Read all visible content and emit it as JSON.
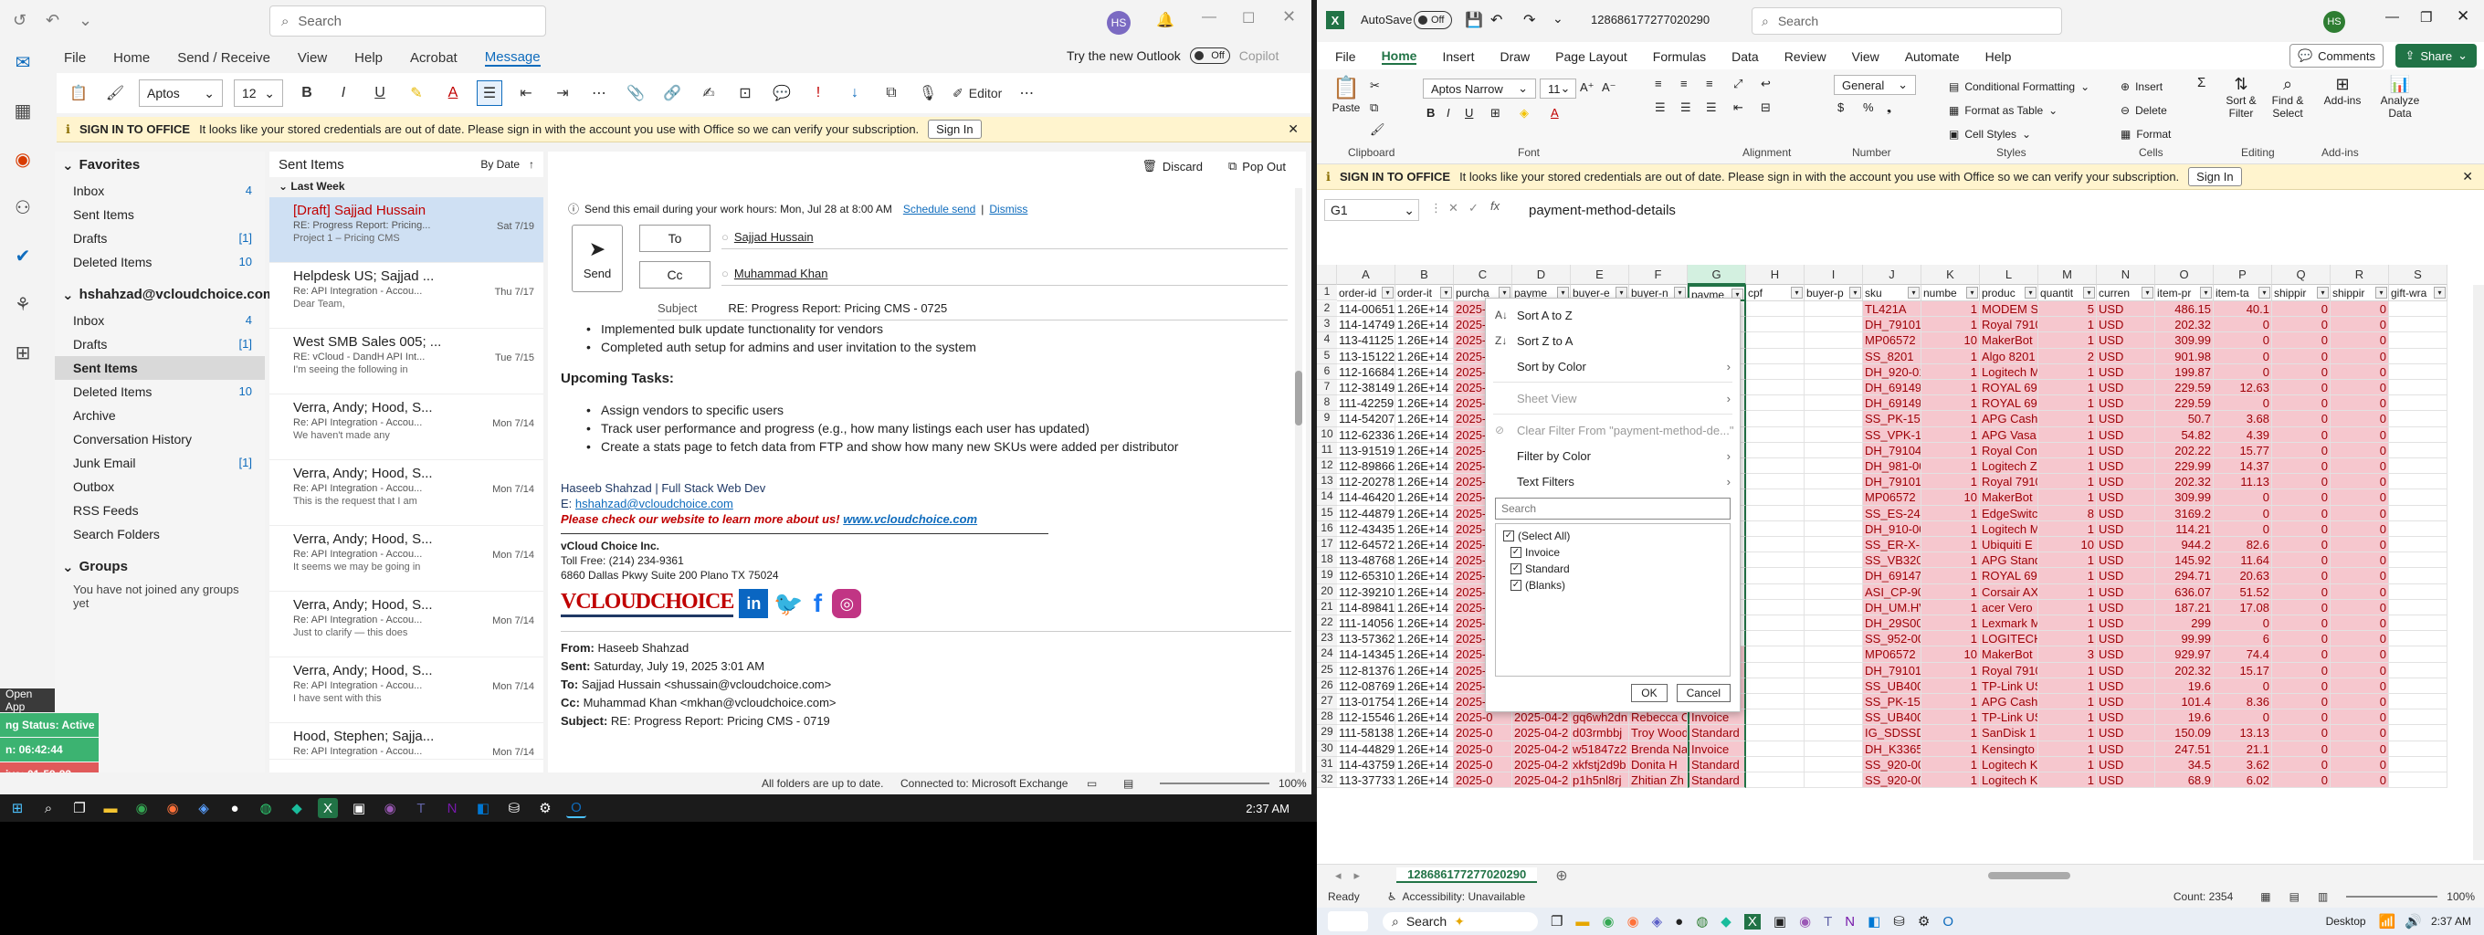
{
  "outlook": {
    "search_placeholder": "Search",
    "avatar": "HS",
    "menu": [
      "File",
      "Home",
      "Send / Receive",
      "View",
      "Help",
      "Acrobat",
      "Message"
    ],
    "try_new": "Try the new Outlook",
    "toggle": "Off",
    "copilot": "Copilot",
    "font_name": "Aptos",
    "font_size": "12",
    "editor": "Editor",
    "infobar": {
      "title": "SIGN IN TO OFFICE",
      "text": "It looks like your stored credentials are out of date. Please sign in with the account you use with Office so we can verify your subscription.",
      "button": "Sign In"
    },
    "favorites_title": "Favorites",
    "favorites": [
      {
        "label": "Inbox",
        "count": "4"
      },
      {
        "label": "Sent Items",
        "count": ""
      },
      {
        "label": "Drafts",
        "count": "[1]"
      },
      {
        "label": "Deleted Items",
        "count": "10"
      }
    ],
    "account": "hshahzad@vcloudchoice.com",
    "folders": [
      {
        "label": "Inbox",
        "count": "4"
      },
      {
        "label": "Drafts",
        "count": "[1]"
      },
      {
        "label": "Sent Items",
        "count": ""
      },
      {
        "label": "Deleted Items",
        "count": "10"
      },
      {
        "label": "Archive",
        "count": ""
      },
      {
        "label": "Conversation History",
        "count": ""
      },
      {
        "label": "Junk Email",
        "count": "[1]"
      },
      {
        "label": "Outbox",
        "count": ""
      },
      {
        "label": "RSS Feeds",
        "count": ""
      },
      {
        "label": "Search Folders",
        "count": ""
      }
    ],
    "groups_title": "Groups",
    "groups_text": "You have not joined any groups yet",
    "list_title": "Sent Items",
    "sort": "By Date",
    "section": "Last Week",
    "messages": [
      {
        "from": "[Draft] Sajjad Hussain",
        "subj": "RE: Progress Report: Pricing...",
        "prev": "Project 1 – Pricing CMS",
        "date": "Sat 7/19"
      },
      {
        "from": "Helpdesk US; Sajjad ...",
        "subj": "Re: API Integration - Accou...",
        "prev": "Dear Team,",
        "date": "Thu 7/17"
      },
      {
        "from": "West SMB Sales 005; ...",
        "subj": "RE: vCloud - DandH API Int...",
        "prev": "I'm seeing the following in",
        "date": "Tue 7/15"
      },
      {
        "from": "Verra, Andy; Hood, S...",
        "subj": "Re: API Integration - Accou...",
        "prev": "We haven't made any",
        "date": "Mon 7/14"
      },
      {
        "from": "Verra, Andy; Hood, S...",
        "subj": "Re: API Integration - Accou...",
        "prev": "This is the request that I am",
        "date": "Mon 7/14"
      },
      {
        "from": "Verra, Andy; Hood, S...",
        "subj": "Re: API Integration - Accou...",
        "prev": "It seems we may be going in",
        "date": "Mon 7/14"
      },
      {
        "from": "Verra, Andy; Hood, S...",
        "subj": "Re: API Integration - Accou...",
        "prev": "Just to clarify — this does",
        "date": "Mon 7/14"
      },
      {
        "from": "Verra, Andy; Hood, S...",
        "subj": "Re: API Integration - Accou...",
        "prev": "I have sent with this",
        "date": "Mon 7/14"
      },
      {
        "from": "Hood, Stephen; Sajja...",
        "subj": "Re: API Integration - Accou...",
        "prev": "",
        "date": "Mon 7/14"
      }
    ],
    "reading": {
      "discard": "Discard",
      "popout": "Pop Out",
      "schedule_notice": "Send this email during your work hours: Mon, Jul 28 at 8:00 AM",
      "schedule_link": "Schedule send",
      "dismiss": "Dismiss",
      "send": "Send",
      "to_label": "To",
      "cc_label": "Cc",
      "to": "Sajjad Hussain",
      "cc": "Muhammad Khan",
      "subject_label": "Subject",
      "subject": "RE: Progress Report: Pricing CMS - 0725",
      "partial_bullet": "Implemented bulk update functionality for vendors",
      "bullet2": "Completed auth setup for admins and user invitation to the system",
      "upcoming": "Upcoming Tasks:",
      "tasks": [
        "Assign vendors to specific users",
        "Track user performance and progress (e.g., how many listings each user has updated)",
        "Create a stats page to fetch data from FTP and show how many new SKUs were added per distributor"
      ],
      "sig_name": "Haseeb Shahzad | Full Stack Web Dev",
      "sig_email_label": "E:",
      "sig_email": "hshahzad@vcloudchoice.com",
      "sig_promo": "Please check our website to learn more about us!",
      "sig_url": "www.vcloudchoice.com",
      "company": "vCloud Choice Inc.",
      "tollfree": "Toll Free: (214) 234-9361",
      "address": "6860 Dallas Pkwy Suite 200 Plano TX 75024",
      "logo": "VCLOUDCHOICE",
      "from_label": "From:",
      "from": "Haseeb Shahzad",
      "sent_label": "Sent:",
      "sent": "Saturday, July 19, 2025 3:01 AM",
      "to2_label": "To:",
      "to2": "Sajjad Hussain <shussain@vcloudchoice.com>",
      "cc2_label": "Cc:",
      "cc2": "Muhammad Khan <mkhan@vcloudchoice.com>",
      "subject2_label": "Subject:",
      "subject2": "RE: Progress Report: Pricing CMS - 0719"
    },
    "status": {
      "left": "All folders are up to date.",
      "mid": "Connected to: Microsoft Exchange",
      "zoom": "100%"
    },
    "side_widget": {
      "open": "Open App",
      "status": "ng Status: Active",
      "t1": "n: 06:42:44",
      "t2": "ive: 01:59:23"
    }
  },
  "taskbar": {
    "time": "2:37 AM"
  },
  "excel": {
    "autosave": "AutoSave",
    "autosave_state": "Off",
    "filename": "1286861772770202​90",
    "search_placeholder": "Search",
    "avatar": "HS",
    "menu": [
      "File",
      "Home",
      "Insert",
      "Draw",
      "Page Layout",
      "Formulas",
      "Data",
      "Review",
      "View",
      "Automate",
      "Help"
    ],
    "comments": "Comments",
    "share": "Share",
    "font_name": "Aptos Narrow",
    "font_size": "11",
    "number_format": "General",
    "styles": [
      "Conditional Formatting",
      "Format as Table",
      "Cell Styles"
    ],
    "cells_btns": [
      "Insert",
      "Delete",
      "Format"
    ],
    "editing_btns": [
      "Sort & Filter",
      "Find & Select"
    ],
    "addins": "Add-ins",
    "analyze": "Analyze Data",
    "paste": "Paste",
    "groups": [
      "Clipboard",
      "Font",
      "Alignment",
      "Number",
      "Styles",
      "Cells",
      "Editing",
      "Add-ins"
    ],
    "infobar": {
      "title": "SIGN IN TO OFFICE",
      "text": "It looks like your stored credentials are out of date. Please sign in with the account you use with Office so we can verify your subscription.",
      "button": "Sign In"
    },
    "namebox": "G1",
    "formula": "payment-method-details",
    "columns": [
      "A",
      "B",
      "C",
      "D",
      "E",
      "F",
      "G",
      "H",
      "I",
      "J",
      "K",
      "L",
      "M",
      "N",
      "O",
      "P",
      "Q",
      "R",
      "S"
    ],
    "headers": [
      "order-id",
      "order-it",
      "purcha",
      "payme",
      "buyer-e",
      "buyer-n",
      "payme",
      "cpf",
      "buyer-p",
      "sku",
      "numbe",
      "produc",
      "quantit",
      "curren",
      "item-pr",
      "item-ta",
      "shippir",
      "shippir",
      "gift-wra"
    ],
    "rows": [
      [
        "114-00651",
        "1.26E+14",
        "2025-0",
        "",
        "",
        "",
        "",
        "",
        "",
        "TL421A",
        "1",
        "MODEM SE",
        "5",
        "USD",
        "486.15",
        "40.1",
        "0",
        "0",
        ""
      ],
      [
        "114-14749",
        "1.26E+14",
        "2025-0",
        "",
        "",
        "",
        "",
        "",
        "",
        "DH_79101",
        "1",
        "Royal 7910",
        "1",
        "USD",
        "202.32",
        "0",
        "0",
        "0",
        ""
      ],
      [
        "113-41125",
        "1.26E+14",
        "2025-0",
        "",
        "",
        "",
        "",
        "",
        "",
        "MP06572",
        "10",
        "MakerBot",
        "1",
        "USD",
        "309.99",
        "0",
        "0",
        "0",
        ""
      ],
      [
        "113-15122",
        "1.26E+14",
        "2025-0",
        "",
        "",
        "",
        "",
        "",
        "",
        "SS_8201",
        "1",
        "Algo 8201",
        "2",
        "USD",
        "901.98",
        "0",
        "0",
        "0",
        ""
      ],
      [
        "112-16684",
        "1.26E+14",
        "2025-0",
        "",
        "",
        "",
        "",
        "",
        "",
        "DH_920-01",
        "1",
        "Logitech M",
        "1",
        "USD",
        "199.87",
        "0",
        "0",
        "0",
        ""
      ],
      [
        "112-38149",
        "1.26E+14",
        "2025-0",
        "",
        "",
        "",
        "",
        "",
        "",
        "DH_69149",
        "1",
        "ROYAL 691",
        "1",
        "USD",
        "229.59",
        "12.63",
        "0",
        "0",
        ""
      ],
      [
        "111-42259",
        "1.26E+14",
        "2025-0",
        "",
        "",
        "",
        "",
        "",
        "",
        "DH_69149",
        "1",
        "ROYAL 691",
        "1",
        "USD",
        "229.59",
        "0",
        "0",
        "0",
        ""
      ],
      [
        "114-54207",
        "1.26E+14",
        "2025-0",
        "",
        "",
        "",
        "",
        "",
        "",
        "SS_PK-15V",
        "1",
        "APG Cash",
        "1",
        "USD",
        "50.7",
        "3.68",
        "0",
        "0",
        ""
      ],
      [
        "112-62336",
        "1.26E+14",
        "2025-0",
        "",
        "",
        "",
        "",
        "",
        "",
        "SS_VPK-15",
        "1",
        "APG Vasa",
        "1",
        "USD",
        "54.82",
        "4.39",
        "0",
        "0",
        ""
      ],
      [
        "113-91519",
        "1.26E+14",
        "2025-0",
        "",
        "",
        "",
        "",
        "",
        "",
        "DH_79104",
        "1",
        "Royal Con",
        "1",
        "USD",
        "202.22",
        "15.77",
        "0",
        "0",
        ""
      ],
      [
        "112-89866",
        "1.26E+14",
        "2025-0",
        "",
        "",
        "",
        "",
        "",
        "",
        "DH_981-00",
        "1",
        "Logitech Z",
        "1",
        "USD",
        "229.99",
        "14.37",
        "0",
        "0",
        ""
      ],
      [
        "112-20278",
        "1.26E+14",
        "2025-0",
        "",
        "",
        "",
        "",
        "",
        "",
        "DH_79101",
        "1",
        "Royal 7910",
        "1",
        "USD",
        "202.32",
        "11.13",
        "0",
        "0",
        ""
      ],
      [
        "114-46420",
        "1.26E+14",
        "2025-0",
        "",
        "",
        "",
        "",
        "",
        "",
        "MP06572",
        "10",
        "MakerBot",
        "1",
        "USD",
        "309.99",
        "0",
        "0",
        "0",
        ""
      ],
      [
        "112-44879",
        "1.26E+14",
        "2025-0",
        "",
        "",
        "",
        "",
        "",
        "",
        "SS_ES-24-2",
        "1",
        "EdgeSwitc",
        "8",
        "USD",
        "3169.2",
        "0",
        "0",
        "0",
        ""
      ],
      [
        "112-43435",
        "1.26E+14",
        "2025-0",
        "",
        "",
        "",
        "",
        "",
        "",
        "DH_910-00",
        "1",
        "Logitech M",
        "1",
        "USD",
        "114.21",
        "0",
        "0",
        "0",
        ""
      ],
      [
        "112-64572",
        "1.26E+14",
        "2025-0",
        "",
        "",
        "",
        "",
        "",
        "",
        "SS_ER-X-S",
        "1",
        "Ubiquiti E",
        "10",
        "USD",
        "944.2",
        "82.6",
        "0",
        "0",
        ""
      ],
      [
        "113-48768",
        "1.26E+14",
        "2025-0",
        "",
        "",
        "",
        "",
        "",
        "",
        "SS_VB320-",
        "1",
        "APG Stand",
        "1",
        "USD",
        "145.92",
        "11.64",
        "0",
        "0",
        ""
      ],
      [
        "112-65310",
        "1.26E+14",
        "2025-0",
        "",
        "",
        "",
        "",
        "",
        "",
        "DH_69147",
        "1",
        "ROYAL 691",
        "1",
        "USD",
        "294.71",
        "20.63",
        "0",
        "0",
        ""
      ],
      [
        "112-39210",
        "1.26E+14",
        "2025-0",
        "",
        "",
        "",
        "",
        "",
        "",
        "ASI_CP-90",
        "1",
        "Corsair AX",
        "1",
        "USD",
        "636.07",
        "51.52",
        "0",
        "0",
        ""
      ],
      [
        "114-89841",
        "1.26E+14",
        "2025-0",
        "",
        "",
        "",
        "",
        "",
        "",
        "DH_UM.HV",
        "1",
        "acer Vero",
        "1",
        "USD",
        "187.21",
        "17.08",
        "0",
        "0",
        ""
      ],
      [
        "111-14056",
        "1.26E+14",
        "2025-0",
        "",
        "",
        "",
        "",
        "",
        "",
        "DH_29S00",
        "1",
        "Lexmark M",
        "1",
        "USD",
        "299",
        "0",
        "0",
        "0",
        ""
      ],
      [
        "113-57362",
        "1.26E+14",
        "2025-0",
        "",
        "",
        "",
        "",
        "",
        "",
        "SS_952-00",
        "1",
        "LOGITECH",
        "1",
        "USD",
        "99.99",
        "6",
        "0",
        "0",
        ""
      ],
      [
        "114-14345",
        "1.26E+14",
        "2025-0",
        "",
        "",
        "",
        "",
        "",
        "",
        "MP06572",
        "10",
        "MakerBot",
        "3",
        "USD",
        "929.97",
        "74.4",
        "0",
        "0",
        ""
      ],
      [
        "112-81376",
        "1.26E+14",
        "2025-0",
        "2025-04-2",
        "5tq7ygs00",
        "Luke",
        "Standard",
        "",
        "",
        "DH_79101",
        "1",
        "Royal 7910",
        "1",
        "USD",
        "202.32",
        "15.17",
        "0",
        "0",
        ""
      ],
      [
        "112-08769",
        "1.26E+14",
        "2025-0",
        "2025-04-2",
        "x5hwwd7j",
        "City of Wa",
        "Standard",
        "",
        "",
        "SS_UB400",
        "1",
        "TP-Link US",
        "1",
        "USD",
        "19.6",
        "0",
        "0",
        "0",
        ""
      ],
      [
        "113-01754",
        "1.26E+14",
        "2025-0",
        "2025-04-2",
        "fwqk27nw",
        "Taleb sale",
        "Standard",
        "",
        "",
        "SS_PK-15V",
        "1",
        "APG Cash",
        "1",
        "USD",
        "101.4",
        "8.36",
        "0",
        "0",
        ""
      ],
      [
        "112-15546",
        "1.26E+14",
        "2025-0",
        "2025-04-2",
        "gq6wh2dn",
        "Rebecca C",
        "Invoice",
        "",
        "",
        "SS_UB400",
        "1",
        "TP-Link US",
        "1",
        "USD",
        "19.6",
        "0",
        "0",
        "0",
        ""
      ],
      [
        "111-58138",
        "1.26E+14",
        "2025-0",
        "2025-04-2",
        "d03rmbbj",
        "Troy Wood",
        "Standard",
        "",
        "",
        "IG_SDSSDI",
        "1",
        "SanDisk 1",
        "1",
        "USD",
        "150.09",
        "13.13",
        "0",
        "0",
        ""
      ],
      [
        "114-44829",
        "1.26E+14",
        "2025-0",
        "2025-04-2",
        "w51847z2",
        "Brenda Na",
        "Invoice",
        "",
        "",
        "DH_K33650",
        "1",
        "Kensingto",
        "1",
        "USD",
        "247.51",
        "21.1",
        "0",
        "0",
        ""
      ],
      [
        "114-43759",
        "1.26E+14",
        "2025-0",
        "2025-04-2",
        "xkfstj2d9b",
        "Donita H",
        "Standard",
        "",
        "",
        "SS_920-00",
        "1",
        "Logitech K",
        "1",
        "USD",
        "34.5",
        "3.62",
        "0",
        "0",
        ""
      ],
      [
        "113-37733",
        "1.26E+14",
        "2025-0",
        "2025-04-2",
        "p1h5nl8rj",
        "Zhitian Zh",
        "Standard",
        "",
        "",
        "SS_920-00",
        "1",
        "Logitech K",
        "1",
        "USD",
        "68.9",
        "6.02",
        "0",
        "0",
        ""
      ]
    ],
    "filter_menu": {
      "sort_az": "Sort A to Z",
      "sort_za": "Sort Z to A",
      "sort_color": "Sort by Color",
      "sheet_view": "Sheet View",
      "clear": "Clear Filter From \"payment-method-de...\"",
      "filter_color": "Filter by Color",
      "text_filters": "Text Filters",
      "search": "Search",
      "options": [
        "(Select All)",
        "Invoice",
        "Standard",
        "(Blanks)"
      ],
      "ok": "OK",
      "cancel": "Cancel"
    },
    "sheet_tab": "128686177277020290",
    "status": {
      "ready": "Ready",
      "accessibility": "Accessibility: Unavailable",
      "count": "Count: 2354",
      "zoom": "100%"
    },
    "taskbar": {
      "search": "Search",
      "desktop": "Desktop",
      "time": "2:37 AM"
    }
  },
  "colors": {
    "outlook_blue": "#0f6cbd",
    "excel_green": "#217346",
    "pink_fill": "#f6c7ce",
    "pink_text": "#9c0006",
    "red": "#c00000"
  }
}
